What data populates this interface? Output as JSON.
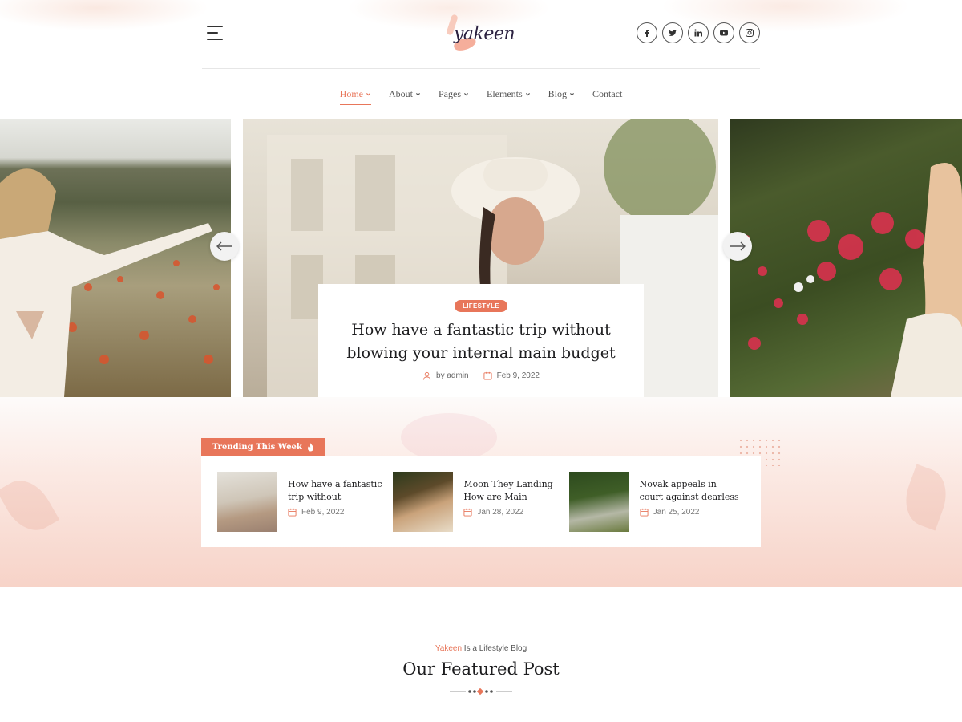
{
  "brand": {
    "logo_text": "yakeen",
    "accent_color": "#e8765a"
  },
  "header": {
    "menu_icon": "hamburger-icon",
    "socials": [
      {
        "name": "facebook-icon"
      },
      {
        "name": "twitter-icon"
      },
      {
        "name": "linkedin-icon"
      },
      {
        "name": "youtube-icon"
      },
      {
        "name": "instagram-icon"
      }
    ]
  },
  "nav": {
    "items": [
      {
        "label": "Home",
        "active": true,
        "dropdown": true
      },
      {
        "label": "About",
        "dropdown": true
      },
      {
        "label": "Pages",
        "dropdown": true
      },
      {
        "label": "Elements",
        "dropdown": true
      },
      {
        "label": "Blog",
        "dropdown": true
      },
      {
        "label": "Contact",
        "dropdown": false
      }
    ]
  },
  "hero": {
    "badge": "LIFESTYLE",
    "title": "How have a fantastic trip without blowing your internal main budget",
    "author": "by admin",
    "date": "Feb 9, 2022"
  },
  "trending": {
    "label": "Trending This Week",
    "items": [
      {
        "title": "How have a fantastic trip without",
        "date": "Feb 9, 2022"
      },
      {
        "title": "Moon They Landing How are Main",
        "date": "Jan 28, 2022"
      },
      {
        "title": "Novak appeals in court against dearless",
        "date": "Jan 25, 2022"
      }
    ]
  },
  "featured": {
    "kicker_brand": "Yakeen",
    "kicker_rest": " Is a Lifestyle Blog",
    "title": "Our Featured Post"
  }
}
